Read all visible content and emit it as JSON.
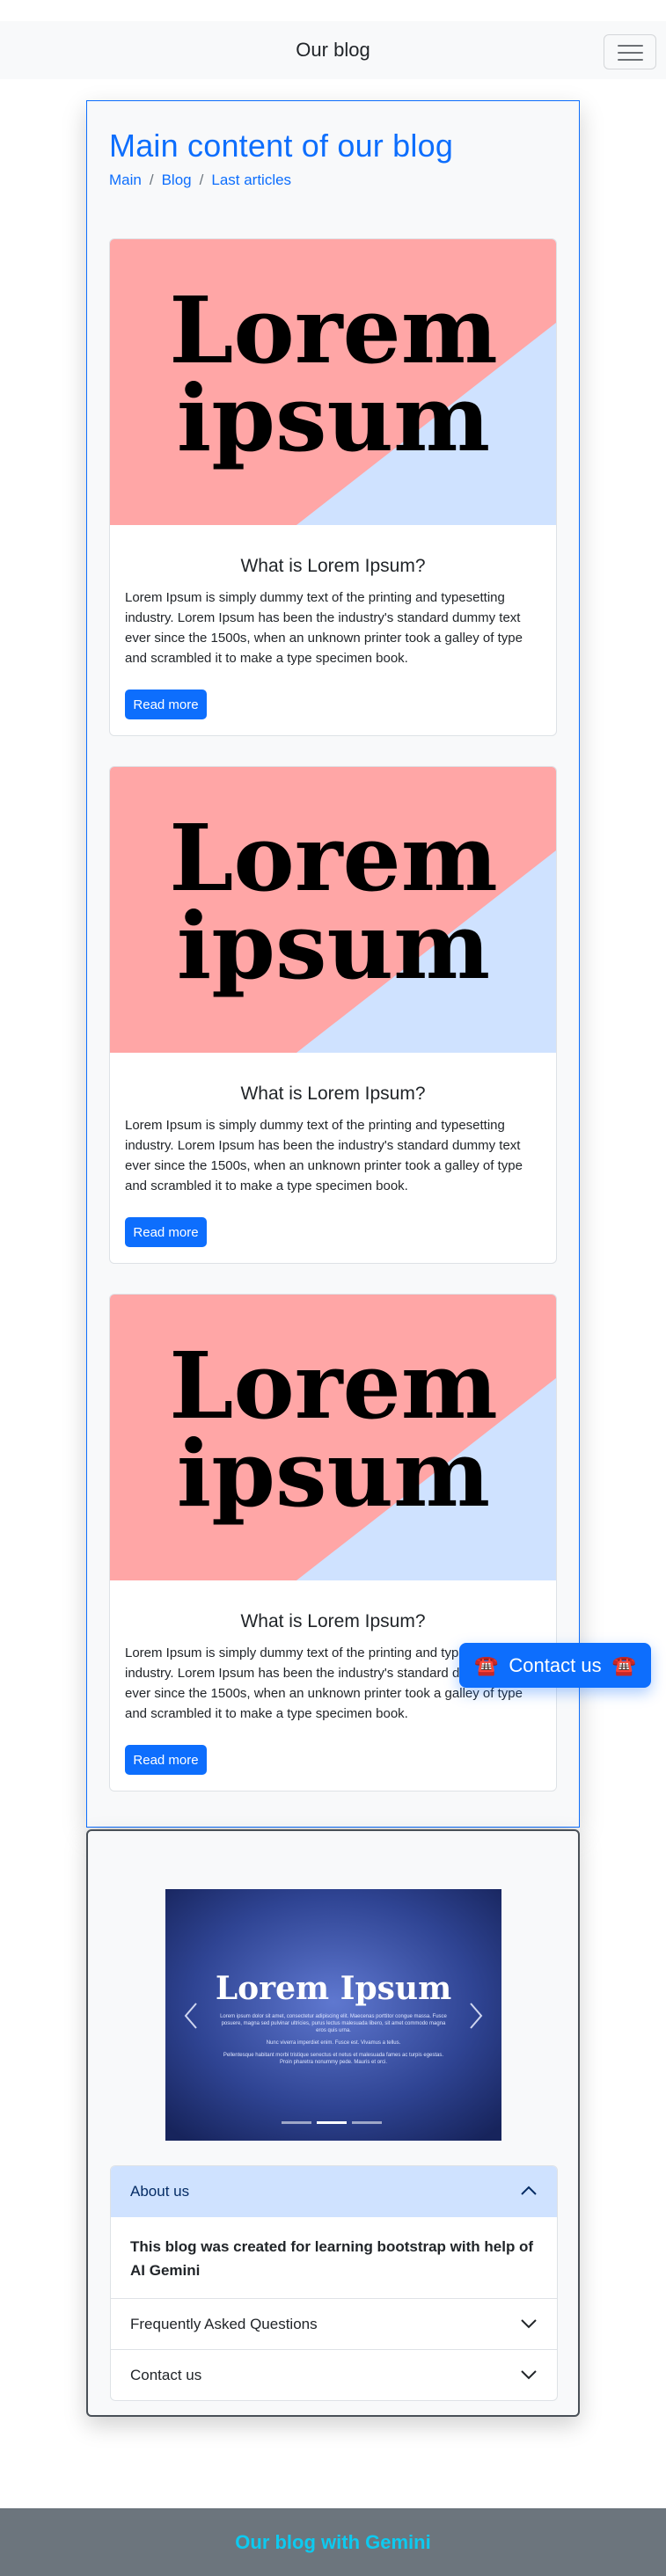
{
  "navbar": {
    "brand": "Our blog"
  },
  "main": {
    "title": "Main content of our blog",
    "breadcrumb": [
      "Main",
      "Blog",
      "Last articles"
    ],
    "cards": [
      {
        "image_text_line1": "Lorem",
        "image_text_line2": "ipsum",
        "title": "What is Lorem Ipsum?",
        "text": "Lorem Ipsum is simply dummy text of the printing and typesetting industry. Lorem Ipsum has been the industry's standard dummy text ever since the 1500s, when an unknown printer took a galley of type and scrambled it to make a type specimen book.",
        "button": "Read more"
      },
      {
        "image_text_line1": "Lorem",
        "image_text_line2": "ipsum",
        "title": "What is Lorem Ipsum?",
        "text": "Lorem Ipsum is simply dummy text of the printing and typesetting industry. Lorem Ipsum has been the industry's standard dummy text ever since the 1500s, when an unknown printer took a galley of type and scrambled it to make a type specimen book.",
        "button": "Read more"
      },
      {
        "image_text_line1": "Lorem",
        "image_text_line2": "ipsum",
        "title": "What is Lorem Ipsum?",
        "text": "Lorem Ipsum is simply dummy text of the printing and typesetting industry. Lorem Ipsum has been the industry's standard dummy text ever since the 1500s, when an unknown printer took a galley of type and scrambled it to make a type specimen book.",
        "button": "Read more"
      }
    ]
  },
  "contact_button": {
    "label": "Contact us",
    "icon": "telephone-emoji-icon",
    "emoji": "☎️"
  },
  "carousel": {
    "slide_title": "Lorem Ipsum",
    "slide_text_1": "Lorem ipsum dolor sit amet, consectetur adipiscing elit. Maecenas porttitor congue massa. Fusce posuere, magna sed pulvinar ultricies, purus lectus malesuada libero, sit amet commodo magna eros quis urna.",
    "slide_text_2": "Nunc viverra imperdiet enim. Fusce est. Vivamus a tellus.",
    "slide_text_3": "Pellentesque habitant morbi tristique senectus et netus et malesuada fames ac turpis egestas. Proin pharetra nonummy pede. Mauris et orci.",
    "indicator_count": 3,
    "active_indicator": 2
  },
  "accordion": {
    "items": [
      {
        "header": "About us",
        "open": true,
        "body": "This blog was created for learning bootstrap with help of AI Gemini"
      },
      {
        "header": "Frequently Asked Questions",
        "open": false
      },
      {
        "header": "Contact us",
        "open": false
      }
    ]
  },
  "footer": {
    "text": "Our blog with Gemini"
  },
  "colors": {
    "primary": "#0d6efd",
    "card_image_pink": "#ffa6a6",
    "card_image_blue": "#cfe2ff",
    "accordion_open_bg": "#cfe2ff",
    "footer_bar": "#6c757d",
    "footer_text": "#0dcaf0",
    "carousel_blue": "#2b3f8f"
  }
}
